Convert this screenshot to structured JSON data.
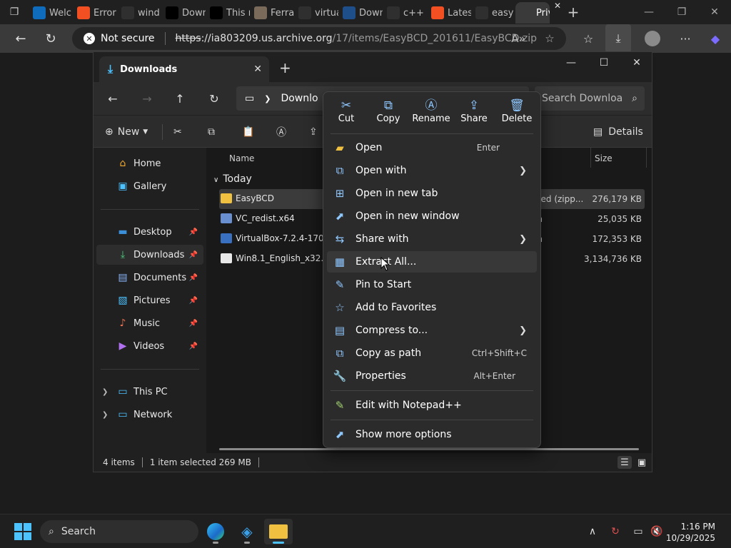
{
  "browser": {
    "tabs": [
      {
        "label": "Welc",
        "fav_color": "#0f6cbd"
      },
      {
        "label": "Error",
        "fav_color": "#f25022"
      },
      {
        "label": "wind",
        "fav_color": "#2f2f2f"
      },
      {
        "label": "Down",
        "fav_color": "#000000"
      },
      {
        "label": "This r",
        "fav_color": "#000000"
      },
      {
        "label": "Ferra",
        "fav_color": "#7a6a5a"
      },
      {
        "label": "virtua",
        "fav_color": "#2f2f2f"
      },
      {
        "label": "Down",
        "fav_color": "#1e4f8a"
      },
      {
        "label": "c++ r",
        "fav_color": "#2f2f2f"
      },
      {
        "label": "Lates",
        "fav_color": "#f25022"
      },
      {
        "label": "easy",
        "fav_color": "#2f2f2f"
      },
      {
        "label": "Priva",
        "fav_color": "#3a3a3a"
      }
    ],
    "security_label": "Not secure",
    "url_scheme": "https",
    "url_host": "://ia803209.us.archive.org",
    "url_path": "/17/items/EasyBCD_201611/EasyBCD.zip"
  },
  "explorer": {
    "tab_title": "Downloads",
    "breadcrumb": "Downlo",
    "search_placeholder": "Search Downloa",
    "new_label": "New",
    "details_label": "Details",
    "sidebar": {
      "home": "Home",
      "gallery": "Gallery",
      "desktop": "Desktop",
      "downloads": "Downloads",
      "documents": "Documents",
      "pictures": "Pictures",
      "music": "Music",
      "videos": "Videos",
      "this_pc": "This PC",
      "network": "Network"
    },
    "columns": {
      "name": "Name",
      "size": "Size"
    },
    "group": "Today",
    "files": [
      {
        "name": "EasyBCD",
        "type": "ssed (zipp...",
        "size": "276,179 KB",
        "selected": true
      },
      {
        "name": "VC_redist.x64",
        "type": "on",
        "size": "25,035 KB",
        "selected": false
      },
      {
        "name": "VirtualBox-7.2.4-170995",
        "type": "on",
        "size": "172,353 KB",
        "selected": false
      },
      {
        "name": "Win8.1_English_x32.iso",
        "type": "",
        "size": "3,134,736 KB",
        "selected": false
      }
    ],
    "status": {
      "items": "4 items",
      "selected": "1 item selected  269 MB"
    }
  },
  "context_menu": {
    "quick_actions": {
      "cut": "Cut",
      "copy": "Copy",
      "rename": "Rename",
      "share": "Share",
      "delete": "Delete"
    },
    "items": {
      "open": "Open",
      "open_sc": "Enter",
      "open_with": "Open with",
      "open_new_tab": "Open in new tab",
      "open_new_window": "Open in new window",
      "share_with": "Share with",
      "extract_all": "Extract All...",
      "pin_start": "Pin to Start",
      "add_fav": "Add to Favorites",
      "compress": "Compress to...",
      "copy_path": "Copy as path",
      "copy_path_sc": "Ctrl+Shift+C",
      "properties": "Properties",
      "properties_sc": "Alt+Enter",
      "notepad": "Edit with Notepad++",
      "more": "Show more options"
    }
  },
  "taskbar": {
    "search": "Search",
    "time": "1:16 PM",
    "date": "10/29/2025"
  }
}
